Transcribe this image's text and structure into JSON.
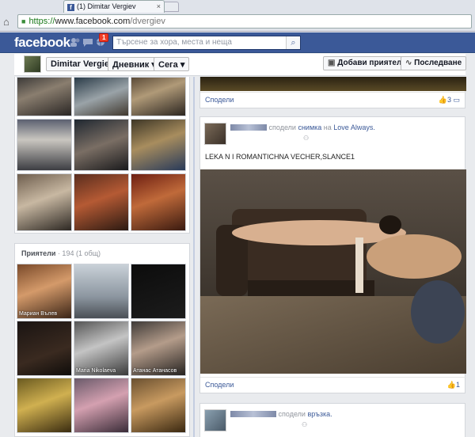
{
  "browser": {
    "tab_title": "(1) Dimitar Vergiev",
    "tab_favicon": "f",
    "tab_close": "×",
    "home_icon": "⌂",
    "url_scheme": "https://",
    "url_host": "www.facebook.com",
    "url_path": "/dvergiev"
  },
  "bluebar": {
    "logo": "facebook",
    "notifications_badge": "1",
    "search_placeholder": "Търсене за хора, места и неща",
    "search_icon": "⌕"
  },
  "timeline_bar": {
    "name": "Dimitar Vergiev",
    "dropdown_1": "Дневник ▾",
    "dropdown_2": "Сега ▾",
    "add_friend": "Добави приятел",
    "follow": "Последване"
  },
  "photos_grid": {
    "rows": 3,
    "cols": 3
  },
  "friends": {
    "title": "Приятели",
    "count": "· 194 (1 общ)",
    "names": [
      "Мариан Вълев",
      "",
      "",
      "",
      "Maria Nikolaeva",
      "Атанас Атанасов",
      "",
      "",
      ""
    ]
  },
  "posts": [
    {
      "action_label": "Сподели",
      "likes": "3",
      "comments_icon": "▭"
    },
    {
      "author": "",
      "verb": "сподели",
      "object": "снимка",
      "prep": "на",
      "target": "Love Always.",
      "text": "LEKA N I ROMANTICHNA VECHER,SLANCE1",
      "action_label": "Сподели",
      "likes": "1"
    },
    {
      "author": "",
      "verb": "сподели",
      "object": "връзка."
    }
  ],
  "colors": {
    "brand": "#3b5998",
    "background": "#e9ebee"
  }
}
